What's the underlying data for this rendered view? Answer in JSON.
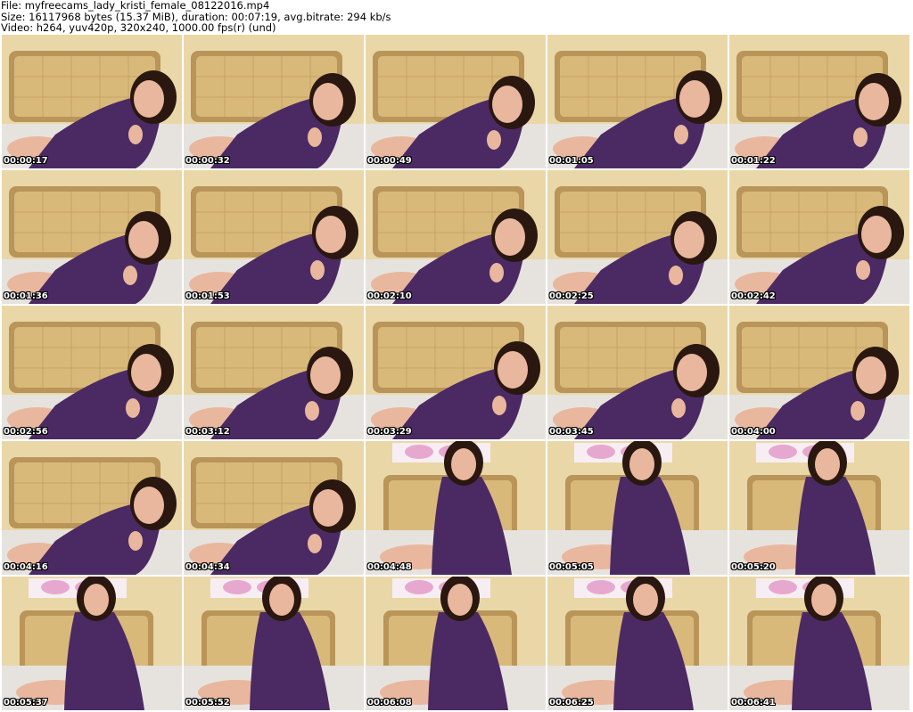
{
  "header": {
    "file_line": "File: myfreecams_lady_kristi_female_08122016.mp4",
    "size_line": "Size: 16117968 bytes (15.37 MiB), duration: 00:07:19, avg.bitrate: 294 kb/s",
    "video_line": "Video: h264, yuv420p, 320x240, 1000.00 fps(r) (und)"
  },
  "colors": {
    "wall": "#ead7a8",
    "headboard": "#d9b97a",
    "headboard_frame": "#b9955a",
    "sweater": "#4b2a63",
    "skin": "#e9b79d",
    "hair": "#2a1710",
    "sheet": "#e6e3df",
    "flowers": "#e7a8cf"
  },
  "thumbnails": [
    {
      "time": "00:00:17",
      "scene": "lying"
    },
    {
      "time": "00:00:32",
      "scene": "lying"
    },
    {
      "time": "00:00:49",
      "scene": "lying"
    },
    {
      "time": "00:01:05",
      "scene": "lying"
    },
    {
      "time": "00:01:22",
      "scene": "lying"
    },
    {
      "time": "00:01:36",
      "scene": "lying"
    },
    {
      "time": "00:01:53",
      "scene": "lying"
    },
    {
      "time": "00:02:10",
      "scene": "lying"
    },
    {
      "time": "00:02:25",
      "scene": "lying"
    },
    {
      "time": "00:02:42",
      "scene": "lying"
    },
    {
      "time": "00:02:56",
      "scene": "lying"
    },
    {
      "time": "00:03:12",
      "scene": "lying"
    },
    {
      "time": "00:03:29",
      "scene": "lying"
    },
    {
      "time": "00:03:45",
      "scene": "lying"
    },
    {
      "time": "00:04:00",
      "scene": "lying"
    },
    {
      "time": "00:04:16",
      "scene": "lying"
    },
    {
      "time": "00:04:34",
      "scene": "lying"
    },
    {
      "time": "00:04:48",
      "scene": "sitting"
    },
    {
      "time": "00:05:05",
      "scene": "sitting"
    },
    {
      "time": "00:05:20",
      "scene": "sitting"
    },
    {
      "time": "00:05:37",
      "scene": "sitting"
    },
    {
      "time": "00:05:52",
      "scene": "sitting"
    },
    {
      "time": "00:06:08",
      "scene": "sitting"
    },
    {
      "time": "00:06:25",
      "scene": "sitting"
    },
    {
      "time": "00:06:41",
      "scene": "sitting"
    }
  ]
}
